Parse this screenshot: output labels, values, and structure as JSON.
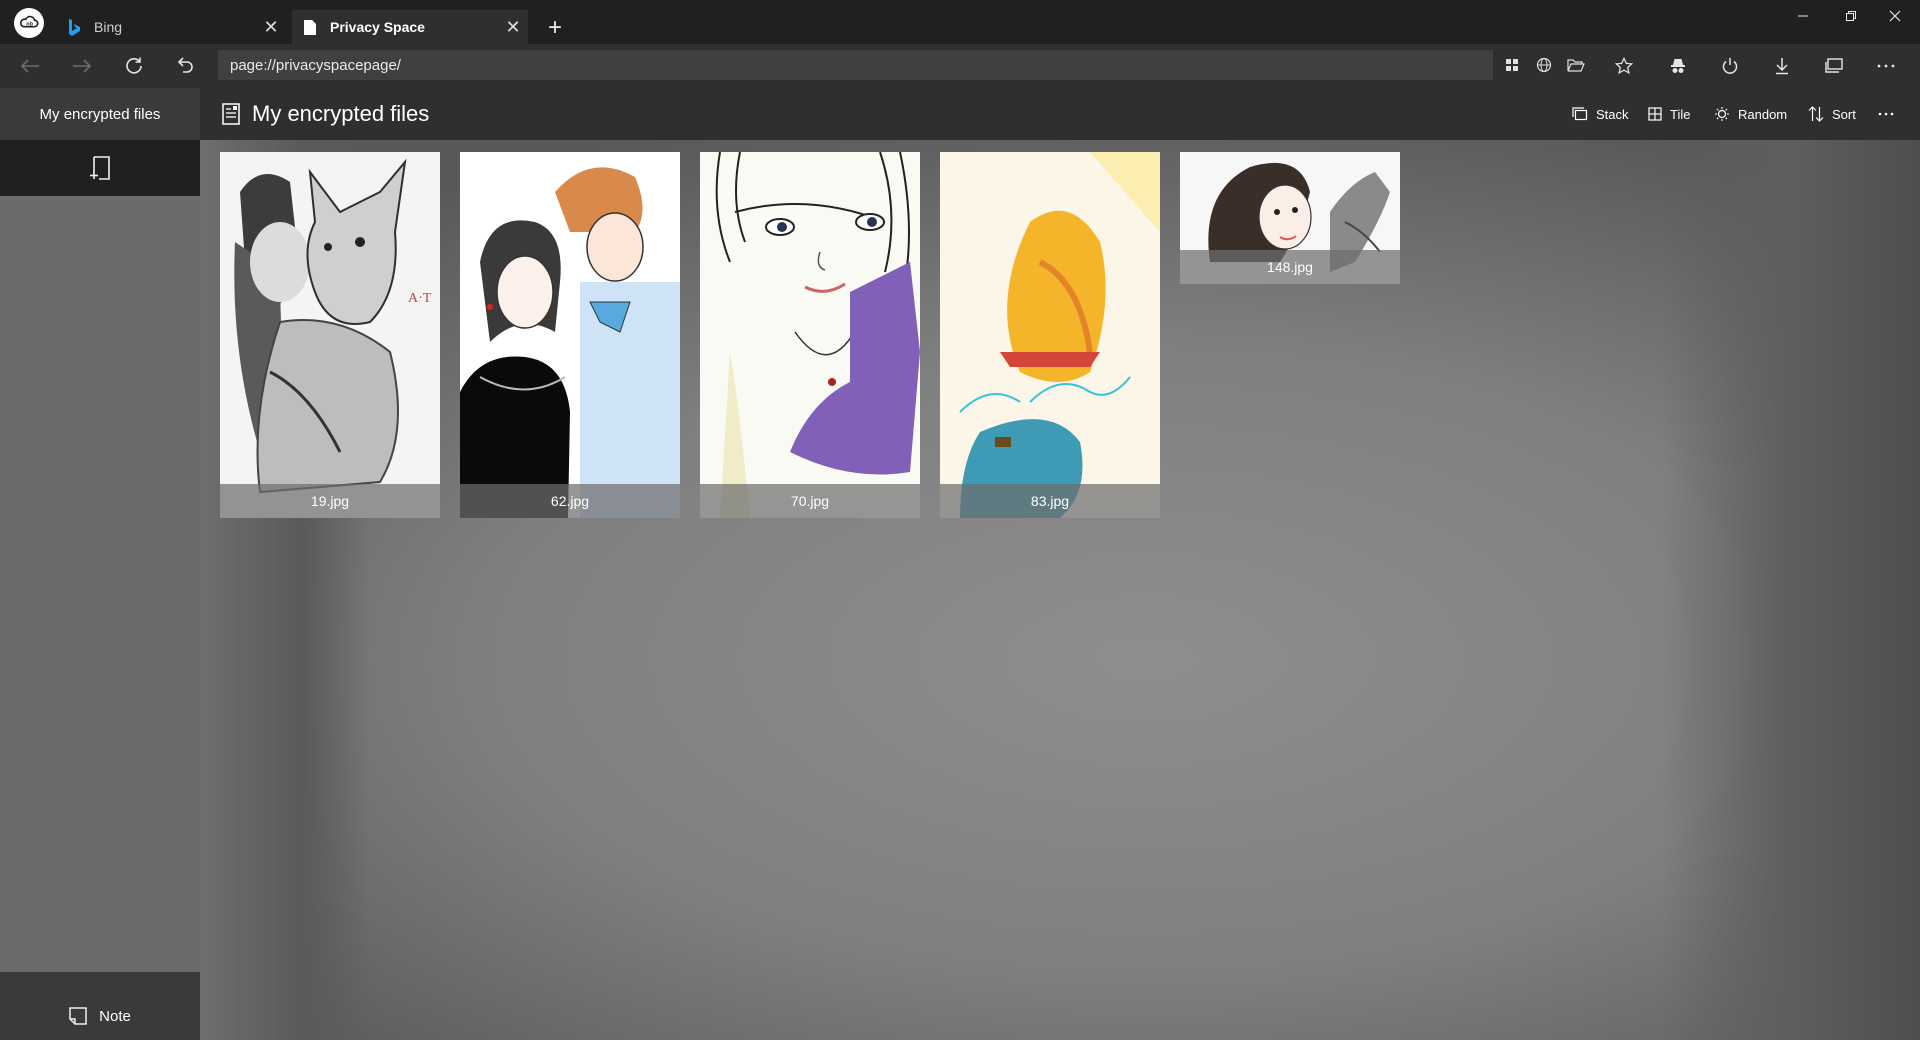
{
  "tabs": [
    {
      "label": "Bing",
      "icon": "bing-icon"
    },
    {
      "label": "Privacy Space",
      "icon": "page-icon",
      "active": true
    }
  ],
  "window_controls": [
    "minimize-icon",
    "restore-icon",
    "close-icon"
  ],
  "address_bar": {
    "url": "page://privacyspacepage/"
  },
  "sidebar": {
    "title": "My encrypted files",
    "add_icon": "add-note-icon",
    "note_label": "Note"
  },
  "main": {
    "heading": "My encrypted files",
    "commands": {
      "stack": "Stack",
      "tile": "Tile",
      "random": "Random",
      "sort": "Sort"
    },
    "files": [
      {
        "name": "19.jpg"
      },
      {
        "name": "62.jpg"
      },
      {
        "name": "70.jpg"
      },
      {
        "name": "83.jpg"
      },
      {
        "name": "148.jpg"
      }
    ]
  },
  "colors": {
    "titlebar": "#202020",
    "toolbar": "#2f2f2f",
    "sidebar_body": "#6b6b6b",
    "content_background": "#808080"
  }
}
